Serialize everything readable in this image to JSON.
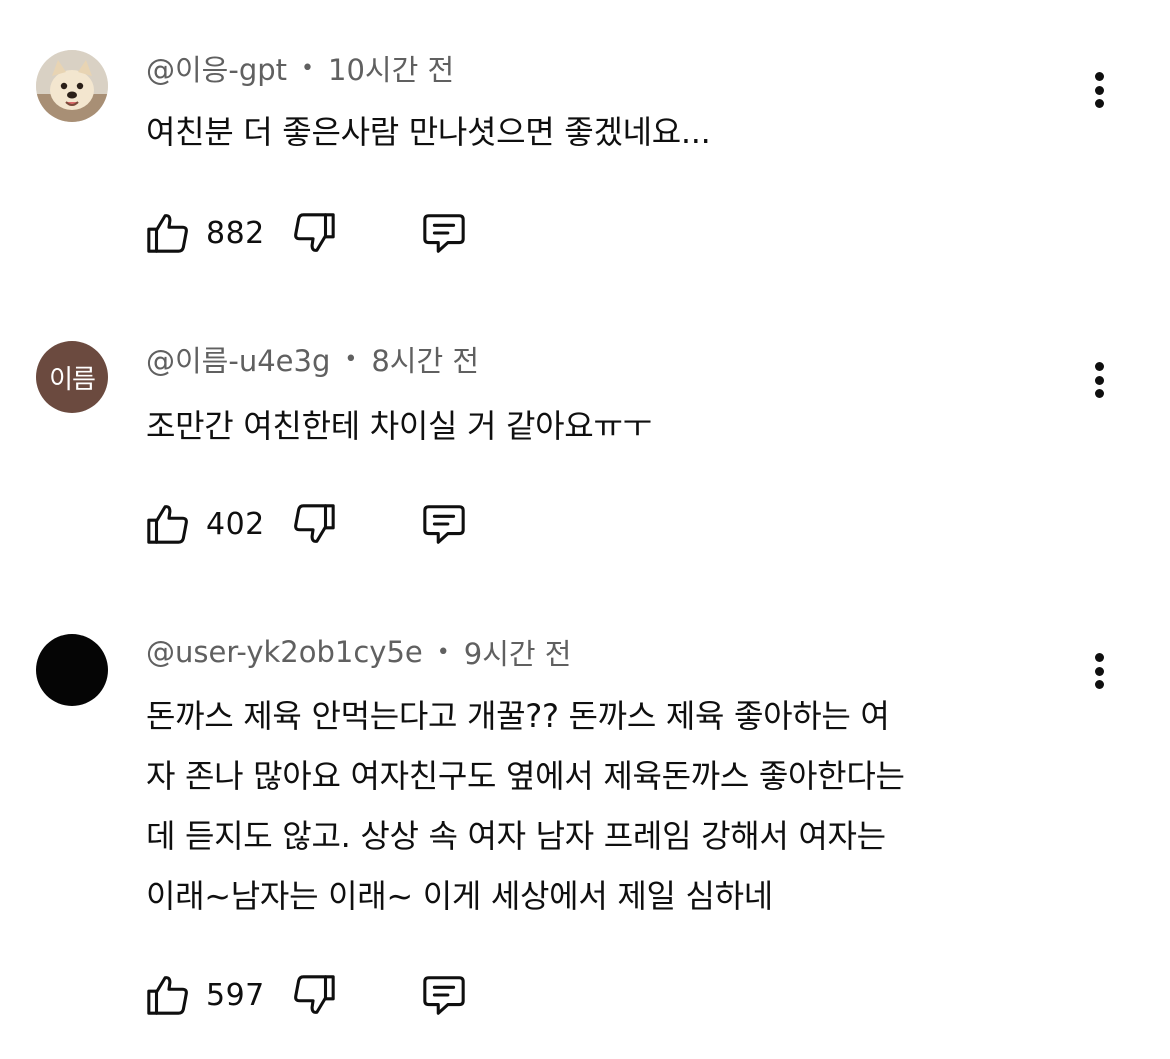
{
  "comments": [
    {
      "author": "@이응-gpt",
      "time": "10시간 전",
      "text": "여친분 더 좋은사람 만나셧으면 좋겠네요...",
      "likes": "882",
      "avatar": {
        "type": "photo",
        "icon": "dog-photo"
      }
    },
    {
      "author": "@이름-u4e3g",
      "time": "8시간 전",
      "text": "조만간 여친한테 차이실 거 같아요ㅠㅜ",
      "likes": "402",
      "avatar": {
        "type": "initials",
        "label": "이름",
        "color": "#6b4a3f"
      }
    },
    {
      "author": "@user-yk2ob1cy5e",
      "time": "9시간 전",
      "text_lines": [
        "돈까스 제육 안먹는다고 개꿀?? 돈까스 제육 좋아하는 여",
        "자 존나 많아요 여자친구도 옆에서 제육돈까스 좋아한다는",
        "데 듣지도 않고. 상상 속 여자 남자 프레임 강해서 여자는",
        "이래~남자는 이래~ 이게 세상에서 제일 심하네"
      ],
      "likes": "597",
      "avatar": {
        "type": "dark",
        "color": "#050505"
      }
    }
  ],
  "separator": "•",
  "icons": {
    "like": "thumbs-up-icon",
    "dislike": "thumbs-down-icon",
    "reply": "reply-bubble-icon",
    "menu": "more-vertical-icon"
  }
}
